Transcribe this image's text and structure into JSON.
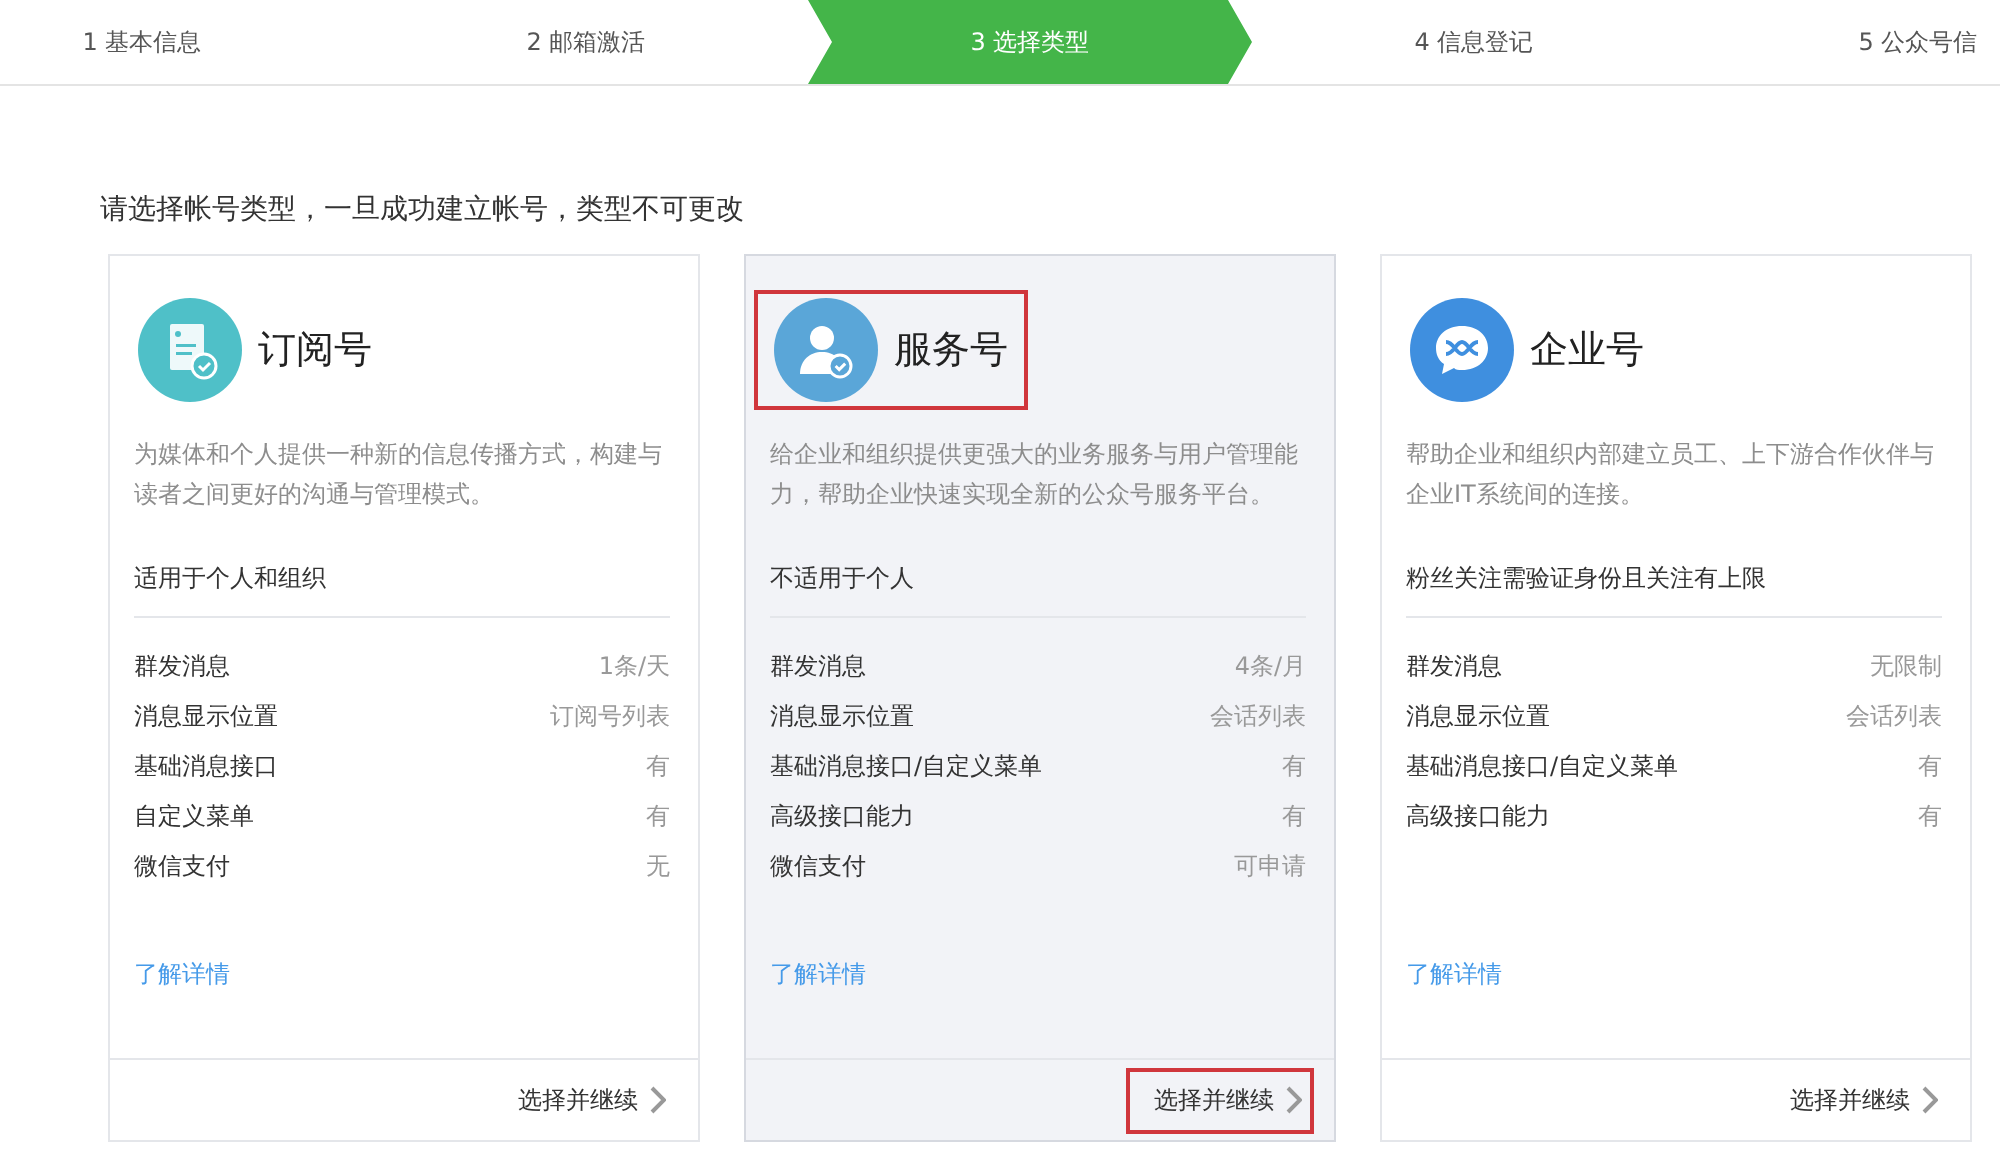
{
  "steps": [
    {
      "label": "1 基本信息",
      "selected": false
    },
    {
      "label": "2 邮箱激活",
      "selected": false
    },
    {
      "label": "3 选择类型",
      "selected": true
    },
    {
      "label": "4 信息登记",
      "selected": false
    },
    {
      "label": "5 公众号信",
      "selected": false
    }
  ],
  "instruction": "请选择帐号类型，一旦成功建立帐号，类型不可更改",
  "cards": [
    {
      "kind": "subscription",
      "title": "订阅号",
      "selected": false,
      "highlighted": false,
      "description": "为媒体和个人提供一种新的信息传播方式，构建与读者之间更好的沟通与管理模式。",
      "audience": "适用于个人和组织",
      "features": [
        {
          "name": "群发消息",
          "value": "1条/天"
        },
        {
          "name": "消息显示位置",
          "value": "订阅号列表"
        },
        {
          "name": "基础消息接口",
          "value": "有"
        },
        {
          "name": "自定义菜单",
          "value": "有"
        },
        {
          "name": "微信支付",
          "value": "无"
        }
      ],
      "link": "了解详情",
      "action": "选择并继续"
    },
    {
      "kind": "service",
      "title": "服务号",
      "selected": true,
      "highlighted": true,
      "description": "给企业和组织提供更强大的业务服务与用户管理能力，帮助企业快速实现全新的公众号服务平台。",
      "audience": "不适用于个人",
      "features": [
        {
          "name": "群发消息",
          "value": "4条/月"
        },
        {
          "name": "消息显示位置",
          "value": "会话列表"
        },
        {
          "name": "基础消息接口/自定义菜单",
          "value": "有"
        },
        {
          "name": "高级接口能力",
          "value": "有"
        },
        {
          "name": "微信支付",
          "value": "可申请"
        }
      ],
      "link": "了解详情",
      "action": "选择并继续"
    },
    {
      "kind": "enterprise",
      "title": "企业号",
      "selected": false,
      "highlighted": false,
      "description": "帮助企业和组织内部建立员工、上下游合作伙伴与企业IT系统间的连接。",
      "audience": "粉丝关注需验证身份且关注有上限",
      "features": [
        {
          "name": "群发消息",
          "value": "无限制"
        },
        {
          "name": "消息显示位置",
          "value": "会话列表"
        },
        {
          "name": "基础消息接口/自定义菜单",
          "value": "有"
        },
        {
          "name": "高级接口能力",
          "value": "有"
        }
      ],
      "link": "了解详情",
      "action": "选择并继续"
    }
  ]
}
